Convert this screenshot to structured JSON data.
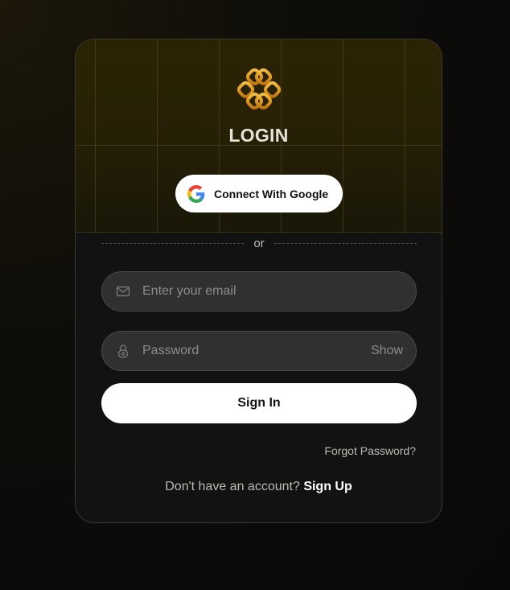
{
  "login": {
    "title": "LOGIN",
    "google_button_label": "Connect With Google",
    "divider_text": "or",
    "email_placeholder": "Enter your email",
    "password_placeholder": "Password",
    "show_password_label": "Show",
    "sign_in_label": "Sign In",
    "forgot_password_label": "Forgot Password?",
    "signup_prompt": "Don't have an account?",
    "signup_link_label": "Sign Up"
  },
  "icons": {
    "logo": "clover-knot-logo-icon",
    "google": "google-g-icon",
    "email": "envelope-icon",
    "password": "padlock-icon"
  },
  "colors": {
    "accent_gold": "#e2a32a",
    "card_background": "#121212",
    "field_background": "#303030",
    "button_background": "#ffffff"
  }
}
